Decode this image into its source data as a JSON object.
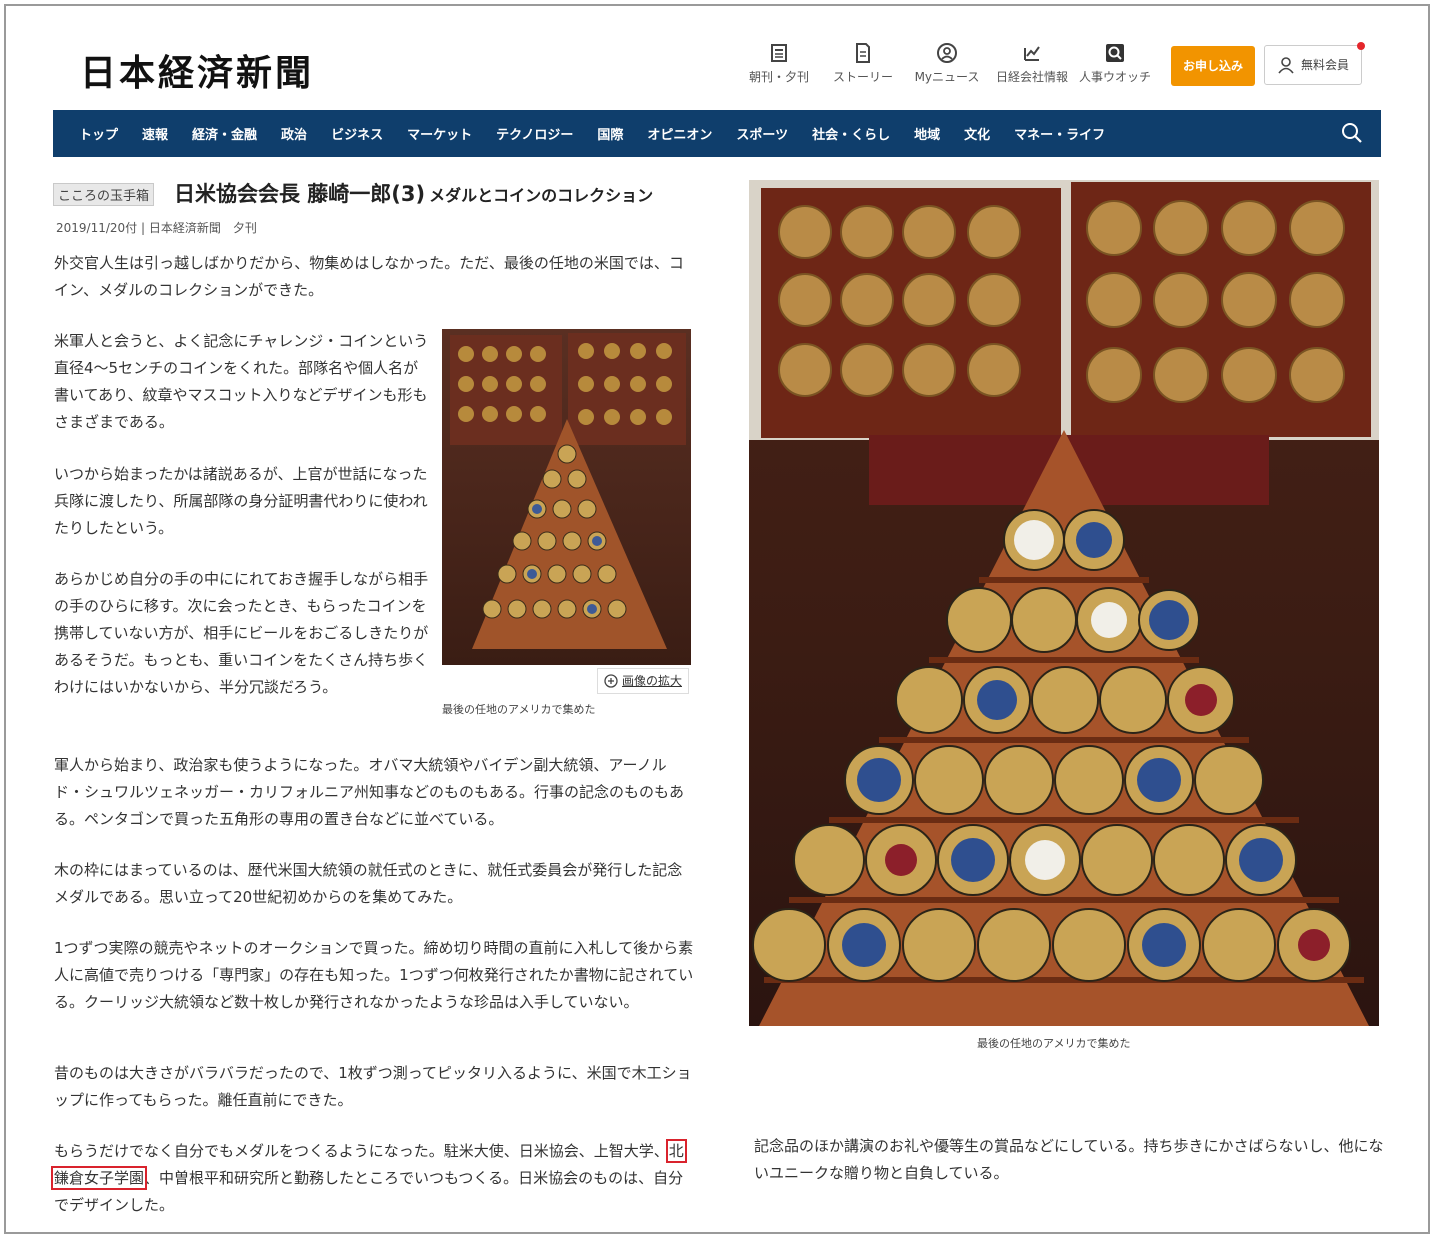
{
  "header": {
    "logo": "日本経済新聞",
    "icons": [
      {
        "label": "朝刊・夕刊",
        "icon": "newspaper-icon"
      },
      {
        "label": "ストーリー",
        "icon": "document-icon"
      },
      {
        "label": "Myニュース",
        "icon": "person-circle-icon"
      },
      {
        "label": "日経会社情報",
        "icon": "chart-icon"
      },
      {
        "label": "人事ウオッチ",
        "icon": "magnifier-icon"
      }
    ],
    "subscribe": "お申し込み",
    "free_member": "無料会員"
  },
  "nav": {
    "items": [
      "トップ",
      "速報",
      "経済・金融",
      "政治",
      "ビジネス",
      "マーケット",
      "テクノロジー",
      "国際",
      "オピニオン",
      "スポーツ",
      "社会・くらし",
      "地域",
      "文化",
      "マネー・ライフ"
    ]
  },
  "article": {
    "tag": "こころの玉手箱",
    "title": "日米協会会長 藤崎一郎(3)",
    "subtitle": "メダルとコインのコレクション",
    "dateline": "2019/11/20付 | 日本経済新聞　夕刊",
    "paragraphs": [
      "外交官人生は引っ越しばかりだから、物集めはしなかった。ただ、最後の任地の米国では、コイン、メダルのコレクションができた。",
      "米軍人と会うと、よく記念にチャレンジ・コインという直径4～5センチのコインをくれた。部隊名や個人名が書いてあり、紋章やマスコット入りなどデザインも形もさまざまである。",
      "いつから始まったかは諸説あるが、上官が世話になった兵隊に渡したり、所属部隊の身分証明書代わりに使われたりしたという。",
      "あらかじめ自分の手の中ににれておき握手しながら相手の手のひらに移す。次に会ったとき、もらったコインを携帯していない方が、相手にビールをおごるしきたりがあるそうだ。もっとも、重いコインをたくさん持ち歩くわけにはいかないから、半分冗談だろう。",
      "軍人から始まり、政治家も使うようになった。オバマ大統領やバイデン副大統領、アーノルド・シュワルツェネッガー・カリフォルニア州知事などのものもある。行事の記念のものもある。ペンタゴンで買った五角形の専用の置き台などに並べている。",
      "木の枠にはまっているのは、歴代米国大統領の就任式のときに、就任式委員会が発行した記念メダルである。思い立って20世紀初めからのを集めてみた。",
      "1つずつ実際の競売やネットのオークションで買った。締め切り時間の直前に入札して後から素人に高値で売りつける「専門家」の存在も知った。1つずつ何枚発行されたか書物に記されている。クーリッジ大統領など数十枚しか発行されなかったような珍品は入手していない。",
      "昔のものは大きさがバラバラだったので、1枚ずつ測ってピッタリ入るように、米国で木工ショップに作ってもらった。離任直前にできた。"
    ],
    "last_before": "もらうだけでなく自分でもメダルをつくるようになった。駐米大使、日米協会、上智大学、",
    "last_highlight": "北鎌倉女子学園",
    "last_after": "、中曽根平和研究所と勤務したところでいつもつくる。日米協会のものは、自分でデザインした。",
    "right_paragraph": "記念品のほか講演のお礼や優等生の賞品などにしている。持ち歩きにかさばらないし、他にないユニークな贈り物と自負している。"
  },
  "images": {
    "small_caption": "最後の任地のアメリカで集めた",
    "zoom_label": "画像の拡大",
    "large_caption": "最後の任地のアメリカで集めた"
  },
  "colors": {
    "nav_bg": "#0f3e6c",
    "subscribe_bg": "#f29400",
    "highlight_border": "#d9232d"
  }
}
